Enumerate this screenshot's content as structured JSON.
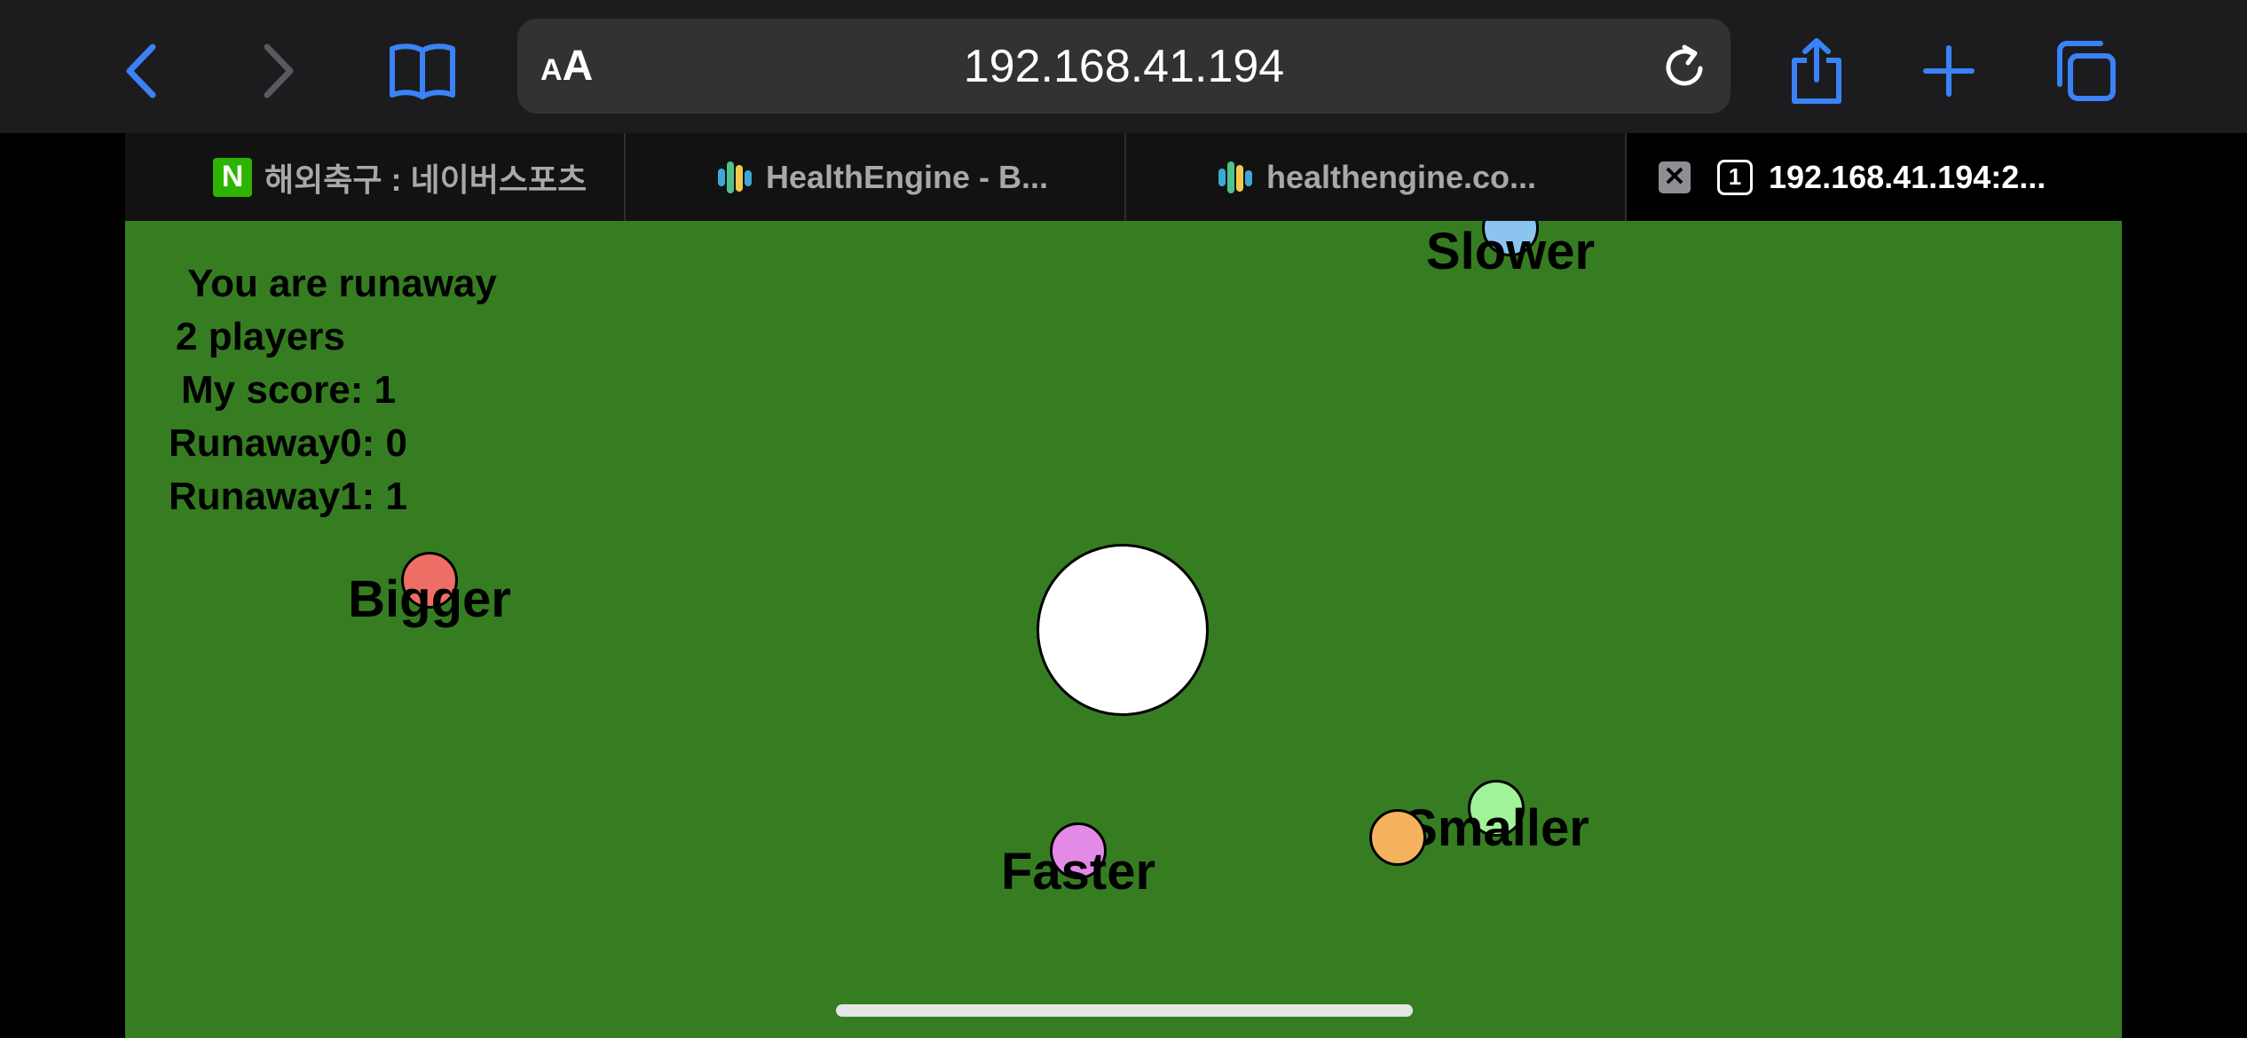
{
  "browser": {
    "address": {
      "aa_small": "A",
      "aa_large": "A",
      "url": "192.168.41.194"
    },
    "icons": {
      "back": "chevron-left-icon",
      "forward": "chevron-right-icon",
      "bookmarks": "book-icon",
      "reload": "reload-icon",
      "share": "share-icon",
      "new_tab": "plus-icon",
      "tabs": "tabs-icon"
    },
    "colors": {
      "accent": "#3b82f6",
      "toolbar_bg": "#1c1c1e"
    }
  },
  "tabs": [
    {
      "label": "해외축구 : 네이버스포츠",
      "favicon": "N",
      "active": false
    },
    {
      "label": "HealthEngine - B...",
      "active": false
    },
    {
      "label": "healthengine.co...",
      "active": false
    },
    {
      "label": "192.168.41.194:2...",
      "count": "1",
      "active": true
    }
  ],
  "game": {
    "background": "#367d22",
    "hud": {
      "role": "You are runaway",
      "players": "2 players",
      "my_score": "My score: 1",
      "scores": [
        "Runaway0: 0",
        "Runaway1: 1"
      ]
    },
    "powerups": [
      {
        "label": "Slower",
        "color": "#8cc4f0"
      },
      {
        "label": "Bigger",
        "color": "#ee6e66"
      },
      {
        "label": "Faster",
        "color": "#e28ae6"
      },
      {
        "label": "Smaller",
        "color": "#a2f29a"
      }
    ],
    "player_colors": {
      "chaser": "#ffffff",
      "runaway": "#f4b25e"
    }
  }
}
